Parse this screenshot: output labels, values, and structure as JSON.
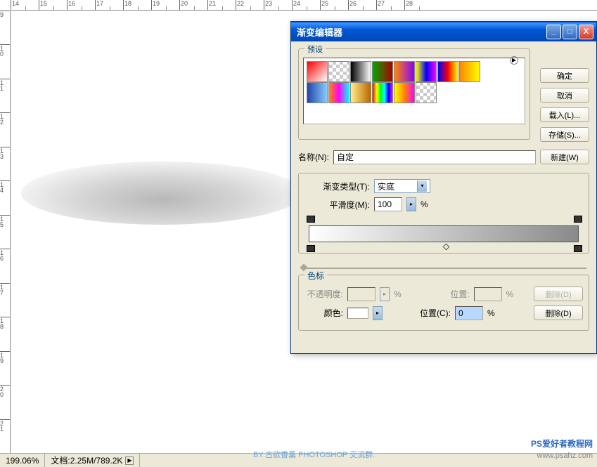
{
  "rulerH": [
    "14",
    "15",
    "16",
    "17",
    "18",
    "19",
    "20",
    "21",
    "22",
    "23",
    "24",
    "25",
    "26",
    "27",
    "28"
  ],
  "rulerV": [
    "9",
    "10",
    "11",
    "12",
    "13",
    "14",
    "15",
    "16",
    "17",
    "18",
    "19",
    "20",
    "21"
  ],
  "status": {
    "zoom": "199.06%",
    "doc_label": "文档:",
    "doc_stats": "2.25M/789.2K"
  },
  "dialog": {
    "title": "渐变编辑器",
    "buttons": {
      "ok": "确定",
      "cancel": "取消",
      "load": "载入(L)...",
      "save": "存储(S)..."
    },
    "presets_label": "预设",
    "name_label": "名称(N):",
    "name_value": "自定",
    "new_btn": "新建(W)",
    "type_label": "渐变类型(T):",
    "type_value": "实底",
    "smooth_label": "平滑度(M):",
    "smooth_value": "100",
    "percent": "%",
    "stops_label": "色标",
    "opacity_label": "不透明度:",
    "color_label": "颜色:",
    "position_label": "位置:",
    "position_label2": "位置(C):",
    "position_value": "0",
    "delete_btn": "删除(D)"
  },
  "swatches_row1": [
    "linear-gradient(135deg,#f00,#fff)",
    "repeating-conic-gradient(#ccc 0 25%,#fff 0 50%) 0/10px 10px",
    "linear-gradient(90deg,#000,#fff)",
    "linear-gradient(90deg,#0a0,#a00)",
    "linear-gradient(90deg,#f80,#80f)",
    "linear-gradient(90deg,#ff0,#00f,#f0f)",
    "linear-gradient(90deg,#00f,#f00,#ff0)",
    "linear-gradient(90deg,#f80,#ff0)"
  ],
  "swatches_row2": [
    "linear-gradient(90deg,#24a,#8cf)",
    "linear-gradient(90deg,#f80,#f0f,#0ff)",
    "linear-gradient(90deg,#fe8,#b60)",
    "linear-gradient(90deg,#f00,#ff0,#0f0,#0ff,#00f,#f0f)",
    "linear-gradient(90deg,#ff0,#f80,#f0f)",
    "repeating-conic-gradient(#ccc 0 25%,#fff 0 50%) 0/10px 10px"
  ],
  "watermark": {
    "line1": "PS爱好者教程网",
    "line2": "www.psahz.com",
    "line3": "BY:古欲香薰  PHOTOSHOP 交流群:"
  }
}
